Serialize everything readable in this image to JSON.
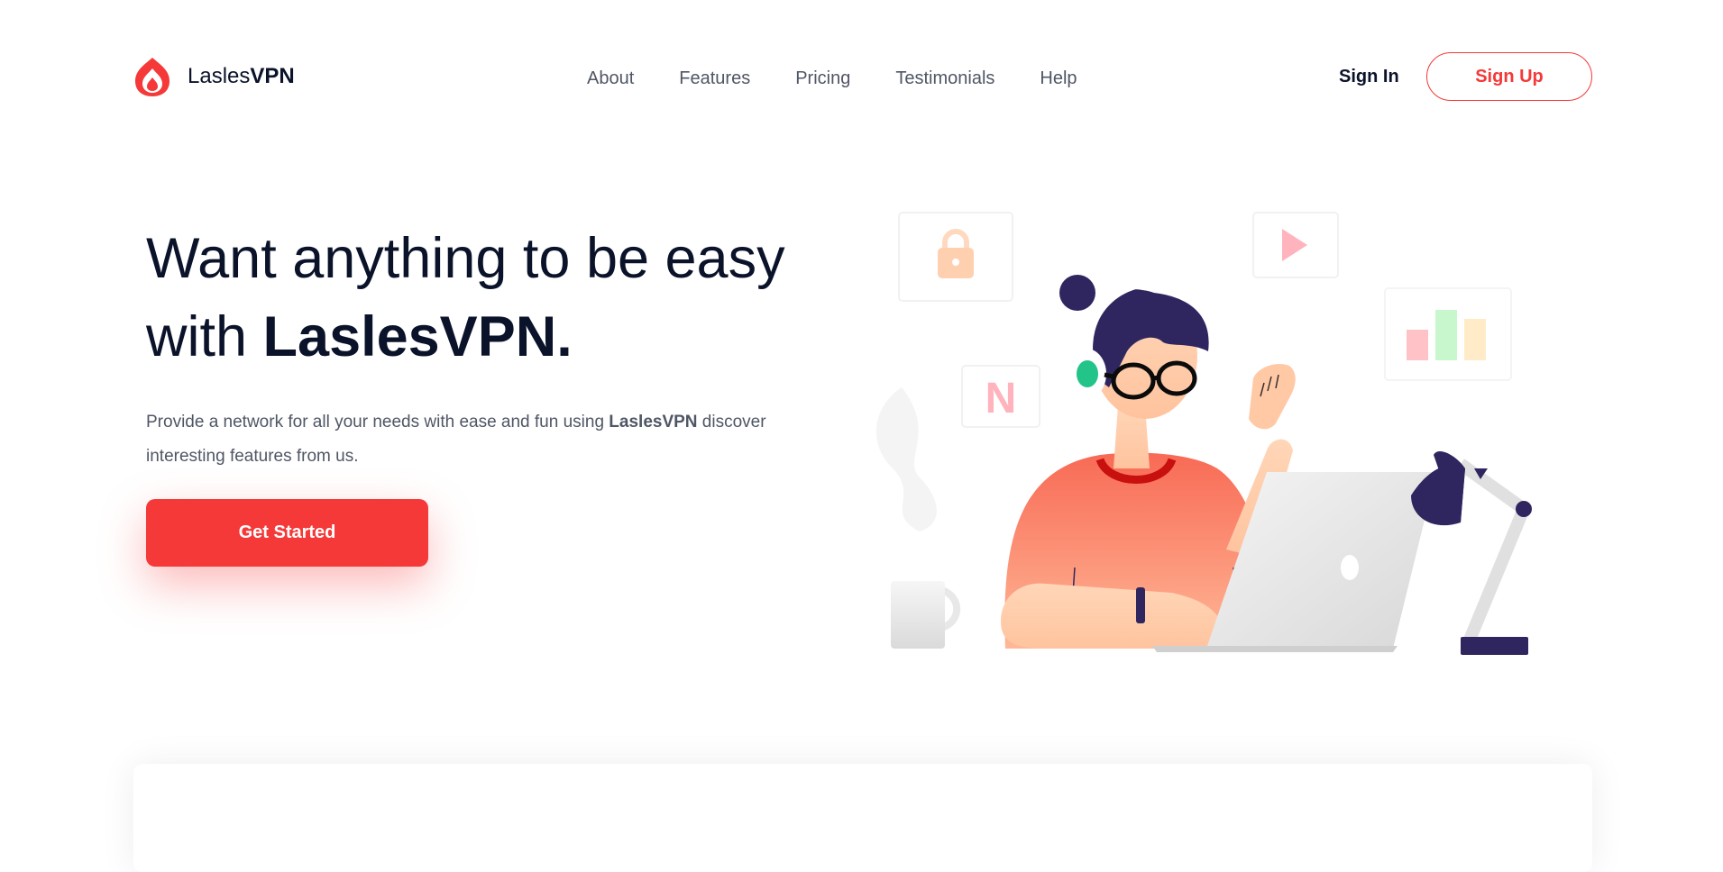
{
  "brand": {
    "name_light": "Lasles",
    "name_bold": "VPN"
  },
  "nav": {
    "items": [
      "About",
      "Features",
      "Pricing",
      "Testimonials",
      "Help"
    ],
    "signin_label": "Sign In",
    "signup_label": "Sign Up"
  },
  "hero": {
    "title_line1": "Want anything to be easy",
    "title_line2_prefix": "with ",
    "title_line2_brand": "LaslesVPN.",
    "desc_prefix": "Provide a network for all your needs with ease and fun using ",
    "desc_brand": "LaslesVPN",
    "desc_suffix": " discover interesting features from us.",
    "cta_label": "Get Started"
  },
  "illustration": {
    "netflix_letter": "N"
  },
  "colors": {
    "accent": "#F53838",
    "heading": "#0B132A",
    "body": "#4F5665",
    "illustration_dark": "#2F2660"
  }
}
